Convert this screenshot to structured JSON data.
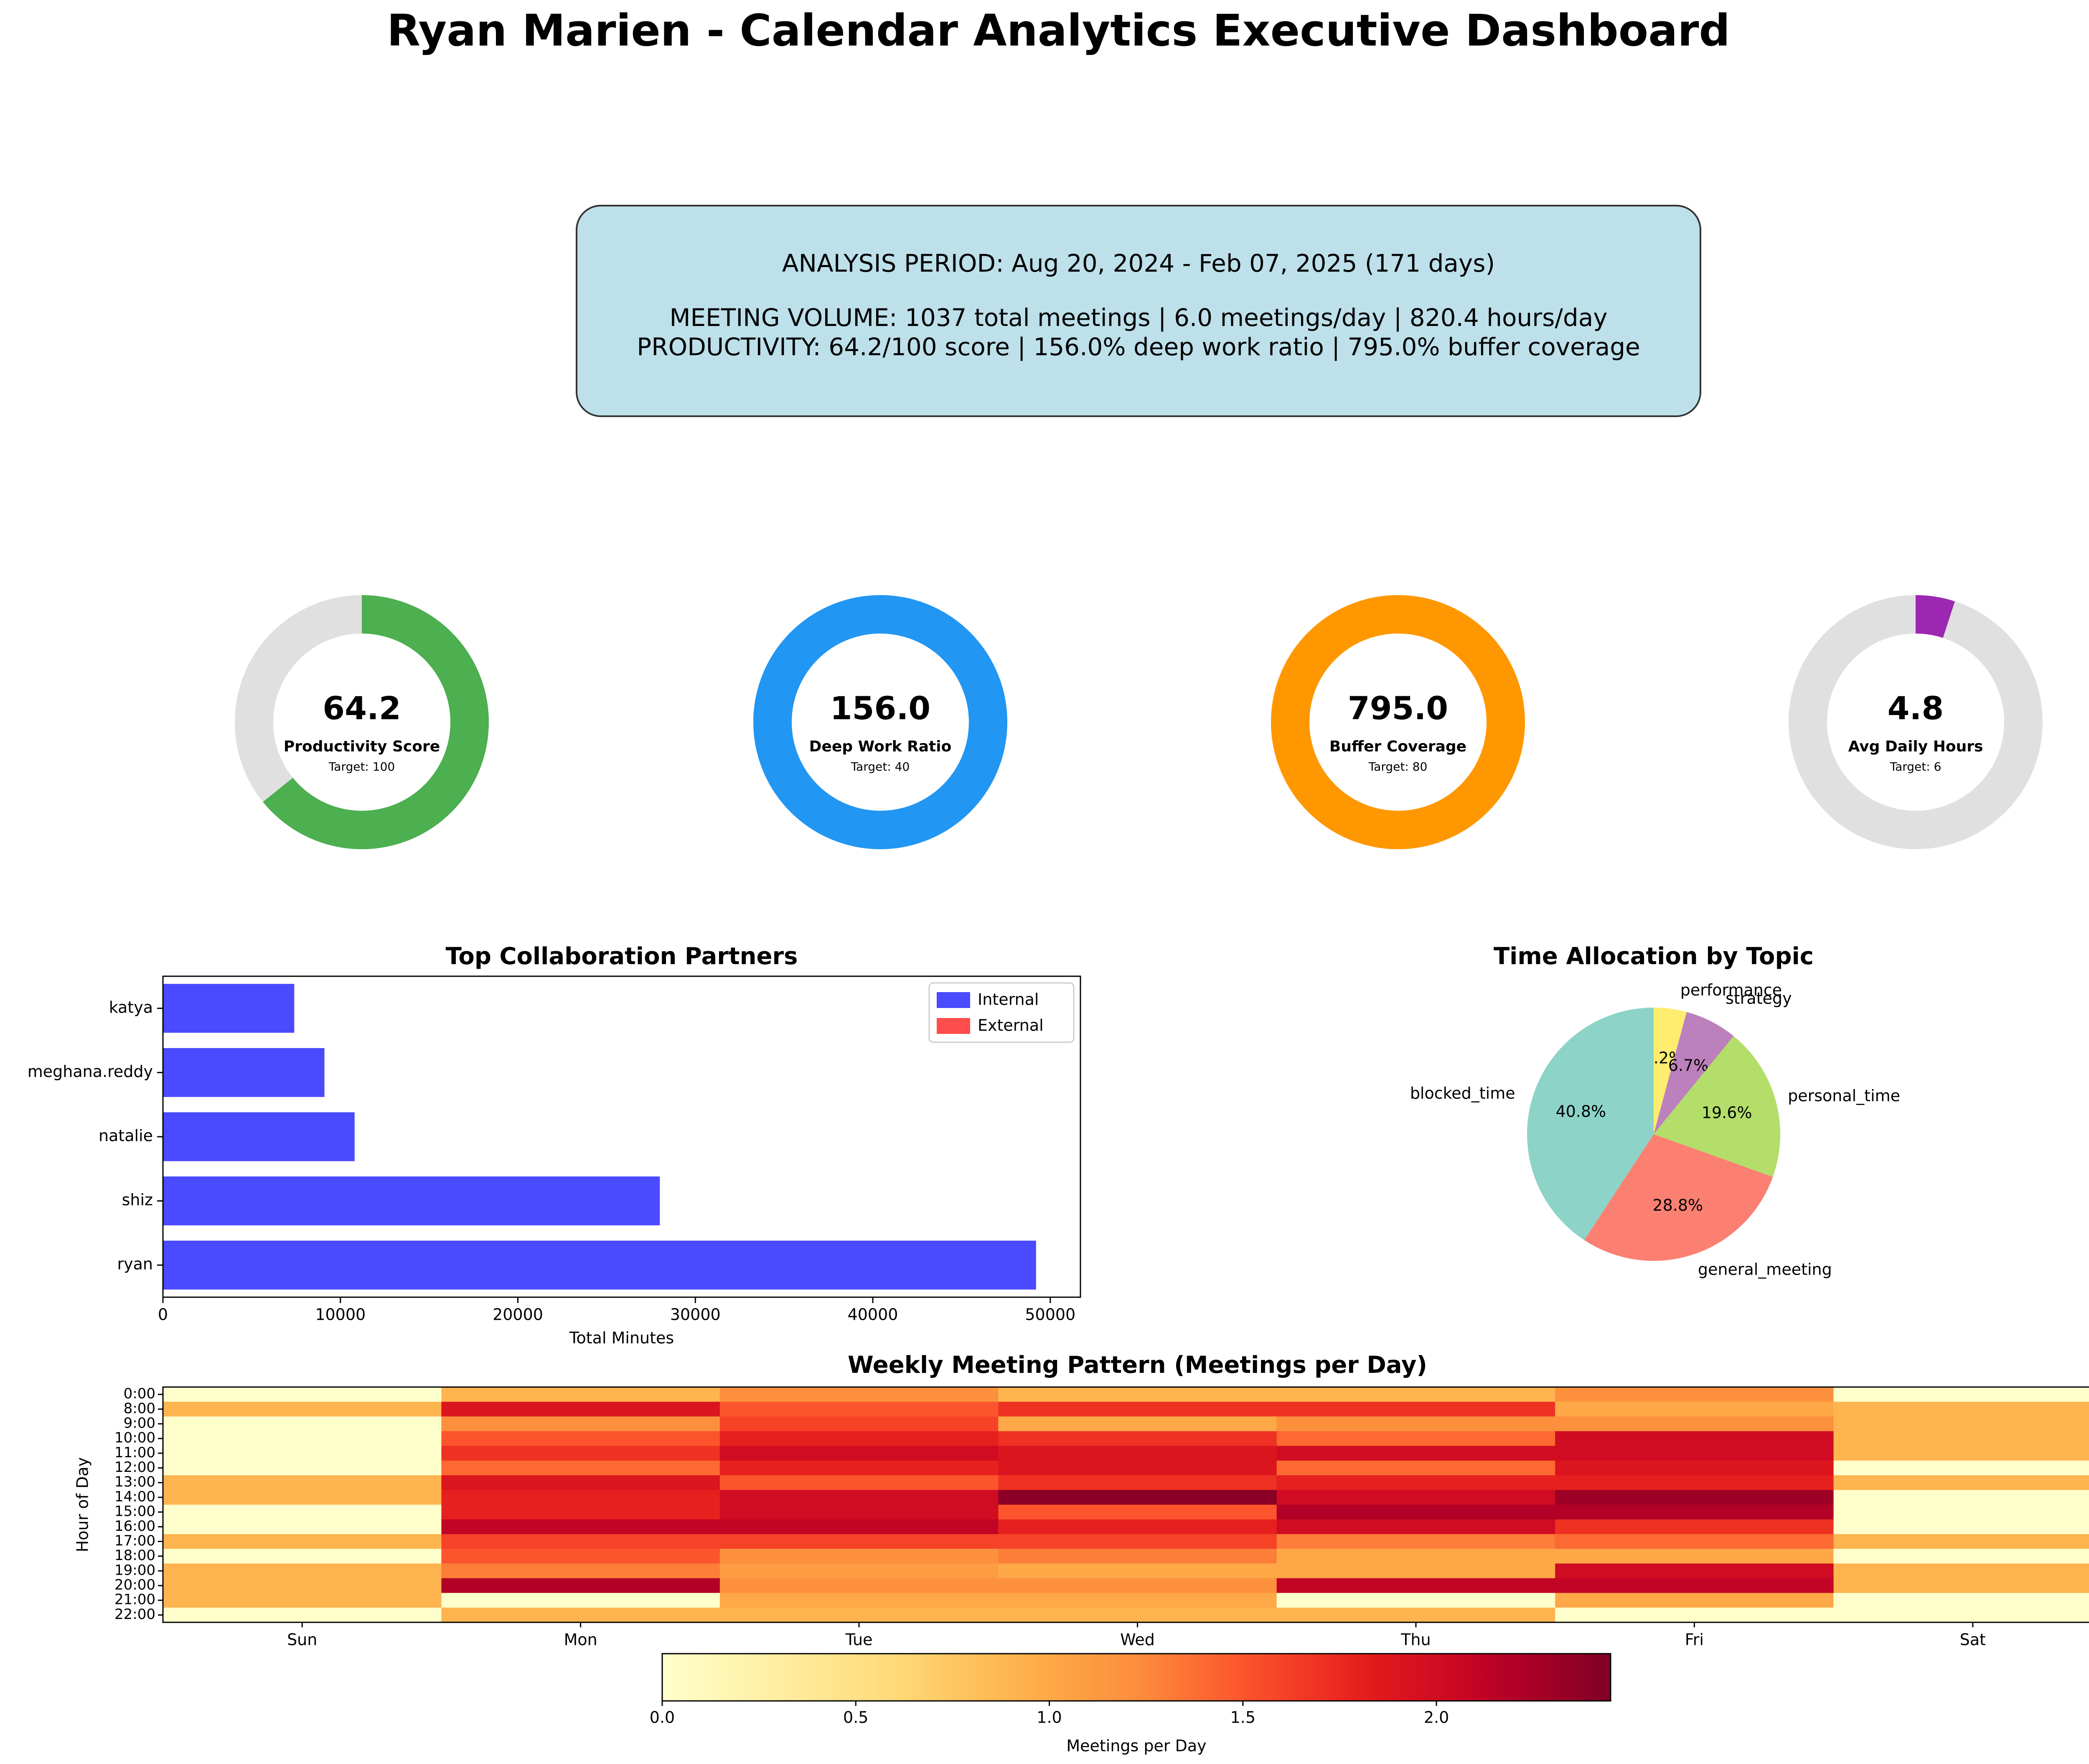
{
  "header": {
    "title": "Ryan Marien - Calendar Analytics Executive Dashboard"
  },
  "summary": {
    "period": "ANALYSIS PERIOD: Aug 20, 2024 - Feb 07, 2025 (171 days)",
    "volume": "MEETING VOLUME: 1037 total meetings | 6.0 meetings/day | 820.4 hours/day",
    "productivity": "PRODUCTIVITY: 64.2/100 score | 156.0% deep work ratio | 795.0% buffer coverage"
  },
  "colors": {
    "gauge_track": "#e0e0e0",
    "internal": "#4a4aff",
    "external": "#ff4d4d",
    "summary_bg": "#bde0ea"
  },
  "chart_data": [
    {
      "type": "gauge",
      "gauges": [
        {
          "value_label": "64.2",
          "label": "Productivity Score",
          "target_label": "Target: 100",
          "fraction": 0.642,
          "color": "#4caf50"
        },
        {
          "value_label": "156.0",
          "label": "Deep Work Ratio",
          "target_label": "Target: 40",
          "fraction": 1.0,
          "color": "#2196f3"
        },
        {
          "value_label": "795.0",
          "label": "Buffer Coverage",
          "target_label": "Target: 80",
          "fraction": 1.0,
          "color": "#ff9800"
        },
        {
          "value_label": "4.8",
          "label": "Avg Daily Hours",
          "target_label": "Target: 6",
          "fraction": 0.05,
          "color": "#9c27b0"
        }
      ]
    },
    {
      "type": "bar",
      "orientation": "horizontal",
      "title": "Top Collaboration Partners",
      "xlabel": "Total Minutes",
      "categories": [
        "ryan",
        "shiz",
        "natalie",
        "meghana.reddy",
        "katya"
      ],
      "series": [
        {
          "name": "Internal",
          "values": [
            49200,
            28000,
            10800,
            9100,
            7400
          ]
        },
        {
          "name": "External",
          "values": [
            0,
            0,
            0,
            0,
            0
          ]
        }
      ],
      "xlim": [
        0,
        51700
      ],
      "xticks": [
        0,
        10000,
        20000,
        30000,
        40000,
        50000
      ],
      "legend": "top-right"
    },
    {
      "type": "pie",
      "title": "Time Allocation by Topic",
      "slices": [
        {
          "label": "performance",
          "pct_label": "4.2%",
          "value": 4.2,
          "color": "#ffed6f"
        },
        {
          "label": "strategy",
          "pct_label": "6.7%",
          "value": 6.7,
          "color": "#bc80bd"
        },
        {
          "label": "personal_time",
          "pct_label": "19.6%",
          "value": 19.6,
          "color": "#b3de69"
        },
        {
          "label": "general_meeting",
          "pct_label": "28.8%",
          "value": 28.8,
          "color": "#fb8072"
        },
        {
          "label": "blocked_time",
          "pct_label": "40.8%",
          "value": 40.8,
          "color": "#8dd3c7"
        }
      ]
    },
    {
      "type": "heatmap",
      "title": "Weekly Meeting Pattern (Meetings per Day)",
      "ylabel": "Hour of Day",
      "colorbar_label": "Meetings per Day",
      "columns": [
        "Sun",
        "Mon",
        "Tue",
        "Wed",
        "Thu",
        "Fri",
        "Sat"
      ],
      "rows": [
        "0:00",
        "8:00",
        "9:00",
        "10:00",
        "11:00",
        "12:00",
        "13:00",
        "14:00",
        "15:00",
        "16:00",
        "17:00",
        "18:00",
        "19:00",
        "20:00",
        "21:00",
        "22:00"
      ],
      "values": [
        [
          0.0,
          0.9,
          1.2,
          0.9,
          0.9,
          1.2,
          0.0
        ],
        [
          0.9,
          1.9,
          1.5,
          1.7,
          1.7,
          1.0,
          0.9
        ],
        [
          0.0,
          1.2,
          1.6,
          1.0,
          1.2,
          1.2,
          0.9
        ],
        [
          0.0,
          1.5,
          1.8,
          1.7,
          1.4,
          2.0,
          0.9
        ],
        [
          0.0,
          1.7,
          2.0,
          1.9,
          2.0,
          2.0,
          0.9
        ],
        [
          0.0,
          1.4,
          1.8,
          1.9,
          1.4,
          1.9,
          0.0
        ],
        [
          0.9,
          1.9,
          1.5,
          1.7,
          1.8,
          1.8,
          0.9
        ],
        [
          0.9,
          1.8,
          2.0,
          2.4,
          2.0,
          2.3,
          0.0
        ],
        [
          0.0,
          1.8,
          2.0,
          1.5,
          2.2,
          2.2,
          0.0
        ],
        [
          0.0,
          2.1,
          2.1,
          1.8,
          2.0,
          1.7,
          0.0
        ],
        [
          0.9,
          1.6,
          1.6,
          1.6,
          1.3,
          1.4,
          0.9
        ],
        [
          0.0,
          1.5,
          1.2,
          1.3,
          1.0,
          1.0,
          0.0
        ],
        [
          0.9,
          1.3,
          1.1,
          1.0,
          1.0,
          2.0,
          0.9
        ],
        [
          0.9,
          2.2,
          1.2,
          1.2,
          2.1,
          2.1,
          0.9
        ],
        [
          0.9,
          0.0,
          1.0,
          1.0,
          0.0,
          1.0,
          0.0
        ],
        [
          0.0,
          0.9,
          0.9,
          0.9,
          0.9,
          0.0,
          0.0
        ]
      ],
      "vmin": 0,
      "vmax": 2.45,
      "colorbar_ticks": [
        "0.0",
        "0.5",
        "1.0",
        "1.5",
        "2.0"
      ],
      "colormap": "YlOrRd"
    }
  ]
}
